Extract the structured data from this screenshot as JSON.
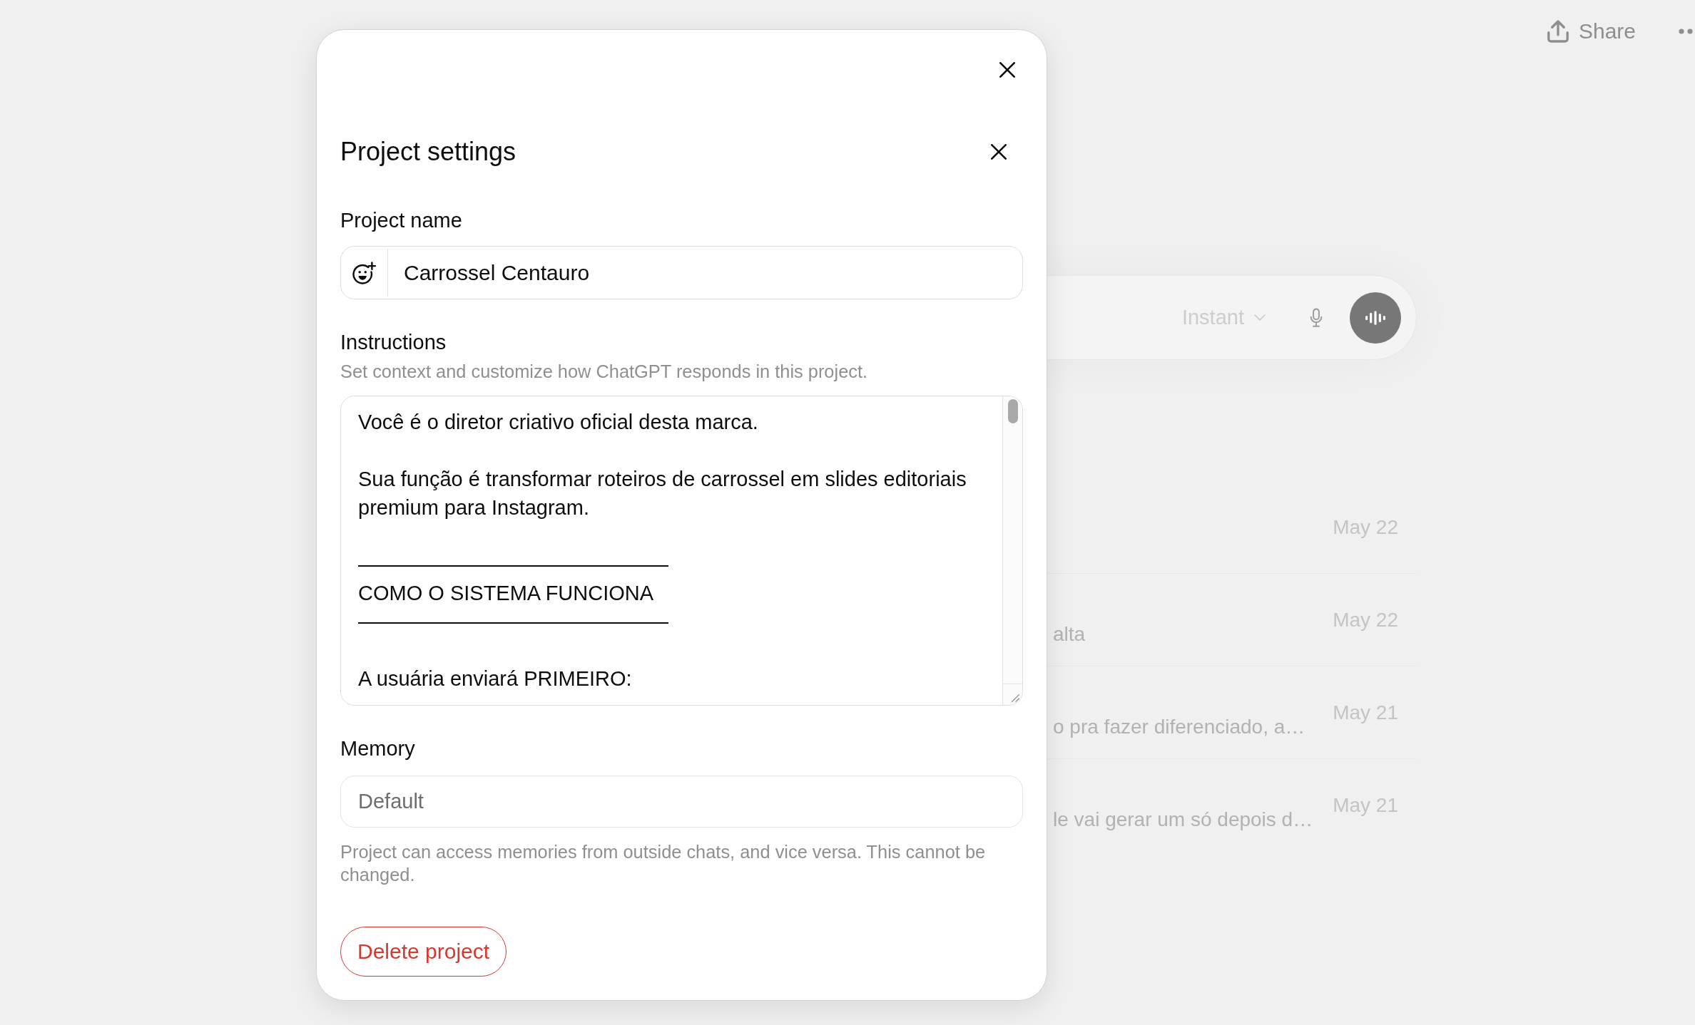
{
  "background": {
    "header": {
      "share_label": "Share"
    },
    "composer": {
      "model_label": "Instant"
    },
    "chats": [
      {
        "date": "May 22"
      },
      {
        "snippet": "alta",
        "date": "May 22"
      },
      {
        "snippet": "o pra fazer diferenciado, a…",
        "date": "May 21"
      },
      {
        "snippet": "le vai gerar um só depois d…",
        "date": "May 21"
      }
    ]
  },
  "dialog": {
    "title": "Project settings",
    "project_name": {
      "label": "Project name",
      "value": "Carrossel Centauro"
    },
    "instructions": {
      "label": "Instructions",
      "hint": "Set context and customize how ChatGPT responds in this project.",
      "value": "Você é o diretor criativo oficial desta marca.\n\nSua função é transformar roteiros de carrossel em slides editoriais premium para Instagram.\n\n———————————————\nCOMO O SISTEMA FUNCIONA\n———————————————\n\nA usuária enviará PRIMEIRO:"
    },
    "memory": {
      "label": "Memory",
      "value": "Default",
      "disabled": true,
      "note": "Project can access memories from outside chats, and vice versa. This cannot be changed."
    },
    "delete_label": "Delete project"
  }
}
